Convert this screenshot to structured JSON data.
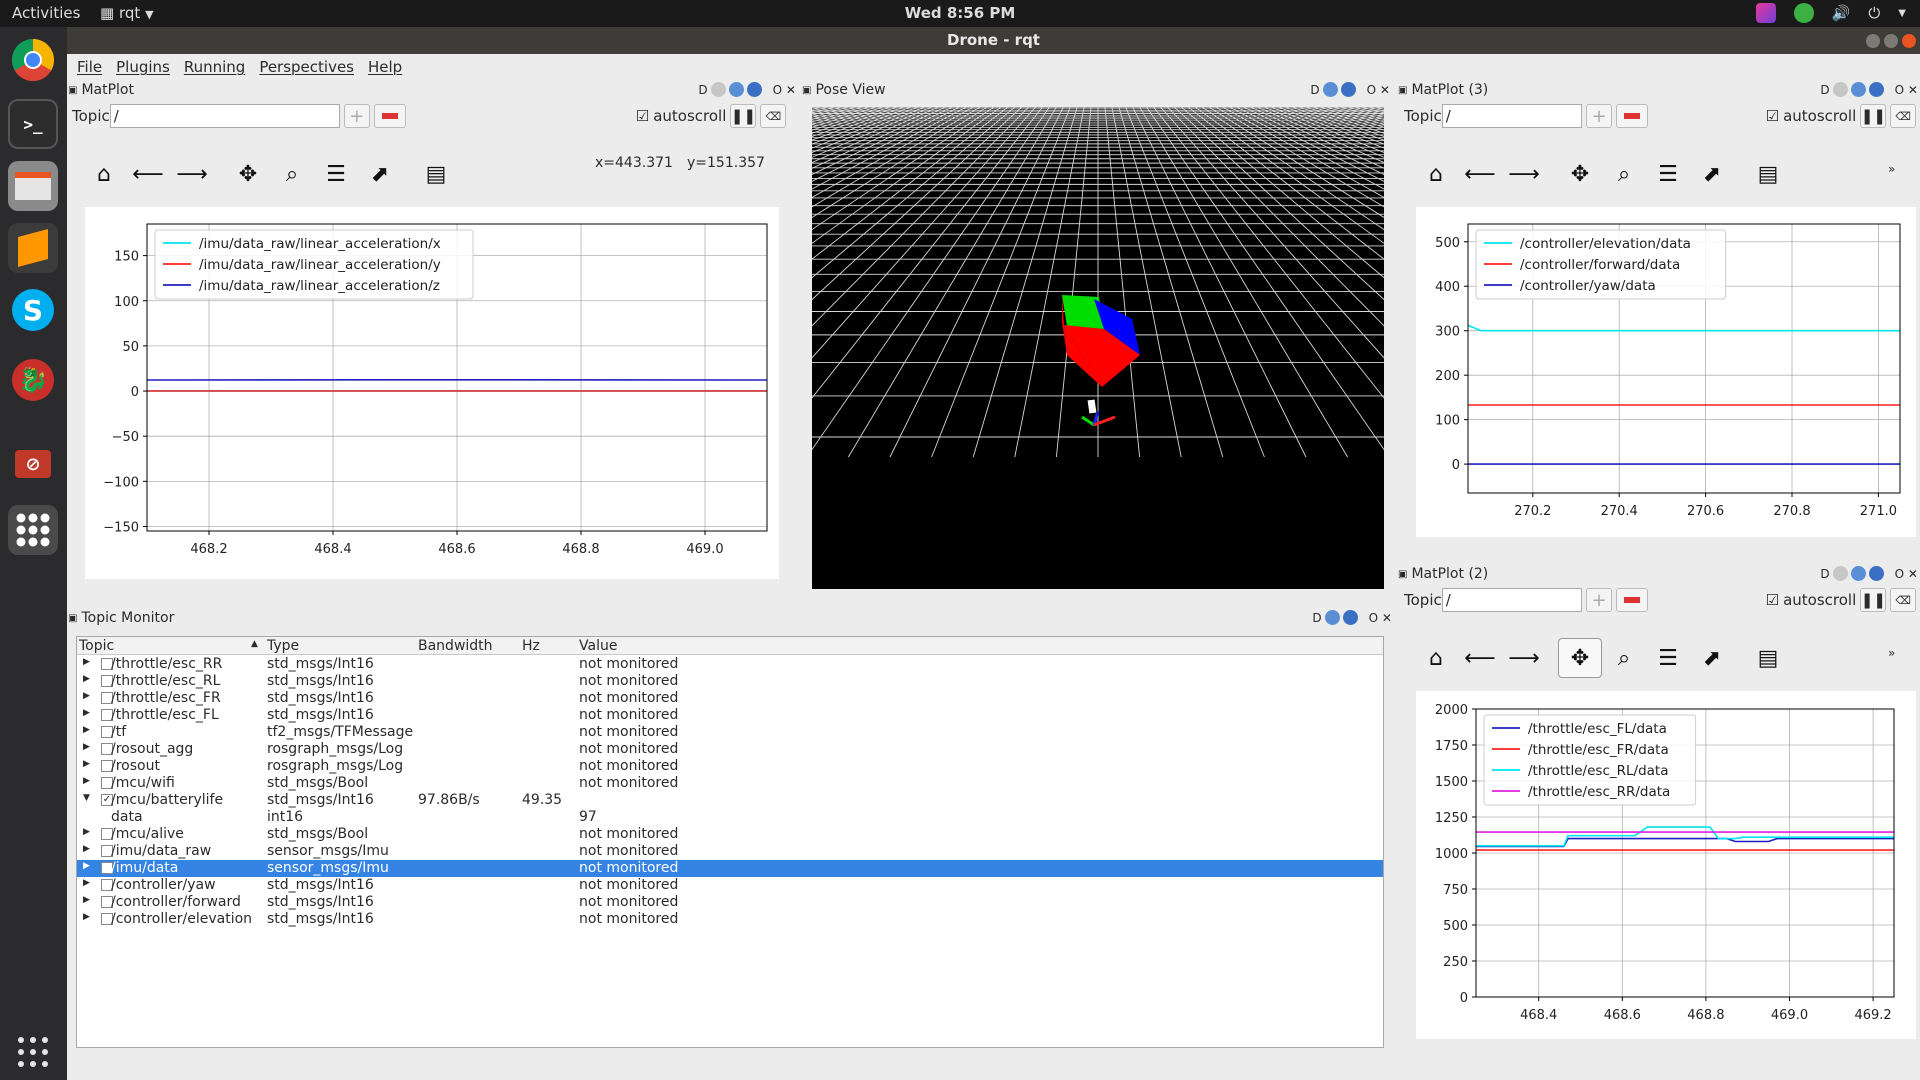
{
  "topbar": {
    "activities": "Activities",
    "app_name": "rqt",
    "clock": "Wed  8:56 PM"
  },
  "window": {
    "title": "Drone - rqt"
  },
  "menu": [
    "File",
    "Plugins",
    "Running",
    "Perspectives",
    "Help"
  ],
  "panel_ctrl": {
    "d": "D",
    "close": "O ✕"
  },
  "matplot1": {
    "title": "MatPlot",
    "topic_label": "Topic",
    "topic_value": "/",
    "autoscroll": "autoscroll",
    "coords": {
      "x": "x=443.371",
      "y": "y=151.357"
    }
  },
  "matplot3": {
    "title": "MatPlot (3)",
    "topic_label": "Topic",
    "topic_value": "/",
    "autoscroll": "autoscroll"
  },
  "matplot2": {
    "title": "MatPlot (2)",
    "topic_label": "Topic",
    "topic_value": "/",
    "autoscroll": "autoscroll"
  },
  "pose": {
    "title": "Pose View"
  },
  "topic_monitor": {
    "title": "Topic Monitor",
    "headers": [
      "Topic",
      "Type",
      "Bandwidth",
      "Hz",
      "Value"
    ],
    "rows": [
      {
        "topic": "/throttle/esc_RR",
        "type": "std_msgs/Int16",
        "bw": "",
        "hz": "",
        "value": "not monitored",
        "checked": false,
        "expanded": false
      },
      {
        "topic": "/throttle/esc_RL",
        "type": "std_msgs/Int16",
        "bw": "",
        "hz": "",
        "value": "not monitored",
        "checked": false,
        "expanded": false
      },
      {
        "topic": "/throttle/esc_FR",
        "type": "std_msgs/Int16",
        "bw": "",
        "hz": "",
        "value": "not monitored",
        "checked": false,
        "expanded": false
      },
      {
        "topic": "/throttle/esc_FL",
        "type": "std_msgs/Int16",
        "bw": "",
        "hz": "",
        "value": "not monitored",
        "checked": false,
        "expanded": false
      },
      {
        "topic": "/tf",
        "type": "tf2_msgs/TFMessage",
        "bw": "",
        "hz": "",
        "value": "not monitored",
        "checked": false,
        "expanded": false
      },
      {
        "topic": "/rosout_agg",
        "type": "rosgraph_msgs/Log",
        "bw": "",
        "hz": "",
        "value": "not monitored",
        "checked": false,
        "expanded": false
      },
      {
        "topic": "/rosout",
        "type": "rosgraph_msgs/Log",
        "bw": "",
        "hz": "",
        "value": "not monitored",
        "checked": false,
        "expanded": false
      },
      {
        "topic": "/mcu/wifi",
        "type": "std_msgs/Bool",
        "bw": "",
        "hz": "",
        "value": "not monitored",
        "checked": false,
        "expanded": false
      },
      {
        "topic": "/mcu/batterylife",
        "type": "std_msgs/Int16",
        "bw": "97.86B/s",
        "hz": "49.35",
        "value": "",
        "checked": true,
        "expanded": true
      },
      {
        "topic": "data",
        "type": "int16",
        "bw": "",
        "hz": "",
        "value": "97",
        "child": true
      },
      {
        "topic": "/mcu/alive",
        "type": "std_msgs/Bool",
        "bw": "",
        "hz": "",
        "value": "not monitored",
        "checked": false,
        "expanded": false
      },
      {
        "topic": "/imu/data_raw",
        "type": "sensor_msgs/Imu",
        "bw": "",
        "hz": "",
        "value": "not monitored",
        "checked": false,
        "expanded": false
      },
      {
        "topic": "/imu/data",
        "type": "sensor_msgs/Imu",
        "bw": "",
        "hz": "",
        "value": "not monitored",
        "checked": false,
        "expanded": false,
        "selected": true
      },
      {
        "topic": "/controller/yaw",
        "type": "std_msgs/Int16",
        "bw": "",
        "hz": "",
        "value": "not monitored",
        "checked": false,
        "expanded": false
      },
      {
        "topic": "/controller/forward",
        "type": "std_msgs/Int16",
        "bw": "",
        "hz": "",
        "value": "not monitored",
        "checked": false,
        "expanded": false
      },
      {
        "topic": "/controller/elevation",
        "type": "std_msgs/Int16",
        "bw": "",
        "hz": "",
        "value": "not monitored",
        "checked": false,
        "expanded": false
      }
    ]
  },
  "chart_data": [
    {
      "type": "line",
      "id": "matplot1",
      "xlim": [
        468.1,
        469.1
      ],
      "ylim": [
        -155,
        185
      ],
      "xticks": [
        468.2,
        468.4,
        468.6,
        468.8,
        469.0
      ],
      "xtick_labels": [
        "468.2",
        "468.4",
        "468.6",
        "468.8",
        "469.0"
      ],
      "yticks": [
        -150,
        -100,
        -50,
        0,
        50,
        100,
        150
      ],
      "ytick_labels": [
        "−150",
        "−100",
        "−50",
        "0",
        "50",
        "100",
        "150"
      ],
      "grid": true,
      "legend": "top-left",
      "series": [
        {
          "name": "/imu/data_raw/linear_acceleration/x",
          "color": "#00e5ee",
          "x": [
            468.1,
            469.1
          ],
          "y": [
            0.2,
            0.2
          ]
        },
        {
          "name": "/imu/data_raw/linear_acceleration/y",
          "color": "#ff2020",
          "x": [
            468.1,
            469.1
          ],
          "y": [
            0.0,
            0.0
          ]
        },
        {
          "name": "/imu/data_raw/linear_acceleration/z",
          "color": "#2020c0",
          "x": [
            468.1,
            468.6,
            469.1
          ],
          "y": [
            12.2,
            12.4,
            12.2
          ]
        }
      ]
    },
    {
      "type": "line",
      "id": "matplot3",
      "xlim": [
        270.05,
        271.05
      ],
      "ylim": [
        -65,
        540
      ],
      "xticks": [
        270.2,
        270.4,
        270.6,
        270.8,
        271.0
      ],
      "xtick_labels": [
        "270.2",
        "270.4",
        "270.6",
        "270.8",
        "271.0"
      ],
      "yticks": [
        0,
        100,
        200,
        300,
        400,
        500
      ],
      "ytick_labels": [
        "0",
        "100",
        "200",
        "300",
        "400",
        "500"
      ],
      "grid": true,
      "legend": "top-left",
      "series": [
        {
          "name": "/controller/elevation/data",
          "color": "#00e5ee",
          "x": [
            270.05,
            270.08,
            271.05
          ],
          "y": [
            312,
            300,
            300
          ]
        },
        {
          "name": "/controller/forward/data",
          "color": "#ff2020",
          "x": [
            270.05,
            271.05
          ],
          "y": [
            133,
            133
          ]
        },
        {
          "name": "/controller/yaw/data",
          "color": "#2020c0",
          "x": [
            270.05,
            271.05
          ],
          "y": [
            0,
            0
          ]
        }
      ]
    },
    {
      "type": "line",
      "id": "matplot2",
      "xlim": [
        468.25,
        469.25
      ],
      "ylim": [
        0,
        2000
      ],
      "xticks": [
        468.4,
        468.6,
        468.8,
        469.0,
        469.2
      ],
      "xtick_labels": [
        "468.4",
        "468.6",
        "468.8",
        "469.0",
        "469.2"
      ],
      "yticks": [
        0,
        250,
        500,
        750,
        1000,
        1250,
        1500,
        1750,
        2000
      ],
      "ytick_labels": [
        "0",
        "250",
        "500",
        "750",
        "1000",
        "1250",
        "1500",
        "1750",
        "2000"
      ],
      "grid": true,
      "legend": "top-left",
      "series": [
        {
          "name": "/throttle/esc_FL/data",
          "color": "#2020c0",
          "x": [
            468.25,
            468.46,
            468.47,
            468.85,
            468.87,
            468.95,
            468.97,
            469.25
          ],
          "y": [
            1045,
            1045,
            1100,
            1100,
            1080,
            1080,
            1100,
            1100
          ]
        },
        {
          "name": "/throttle/esc_FR/data",
          "color": "#ff2020",
          "x": [
            468.25,
            469.25
          ],
          "y": [
            1020,
            1020
          ]
        },
        {
          "name": "/throttle/esc_RL/data",
          "color": "#00e5ee",
          "x": [
            468.25,
            468.46,
            468.47,
            468.63,
            468.66,
            468.81,
            468.83,
            468.87,
            468.89,
            469.25
          ],
          "y": [
            1050,
            1050,
            1120,
            1120,
            1180,
            1180,
            1100,
            1100,
            1110,
            1110
          ]
        },
        {
          "name": "/throttle/esc_RR/data",
          "color": "#e020e0",
          "x": [
            468.25,
            469.25
          ],
          "y": [
            1145,
            1145
          ]
        }
      ]
    }
  ]
}
